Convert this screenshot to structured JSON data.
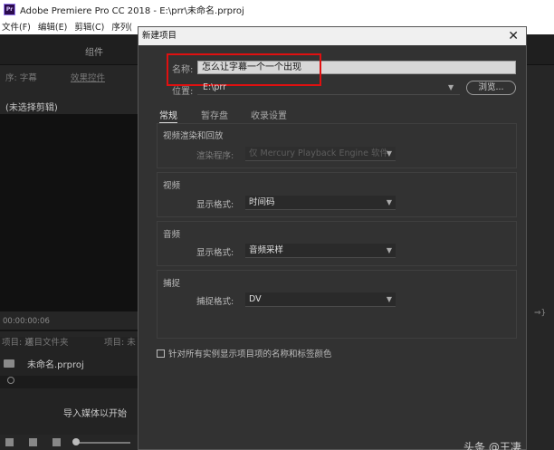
{
  "app": {
    "title": "Adobe Premiere Pro CC 2018 - E:\\prr\\未命名.prproj",
    "menu": [
      "文件(F)",
      "编辑(E)",
      "剪辑(C)",
      "序列("
    ]
  },
  "background": {
    "zujian": "组件",
    "left_tab_1": "序: 字幕",
    "left_tab_2": "效果控件",
    "no_clip": "(未选择剪辑)",
    "timecode": "00:00:00:06",
    "project_tab_1": "项目: 送",
    "project_tab_2": "项目文件夹",
    "project_tab_3": "项目: 未",
    "project_file": "未命名.prproj",
    "import_media": "导入媒体以开始",
    "right_arrow": "⇒}",
    "watermark": "头条 @王凄"
  },
  "dialog": {
    "title": "新建项目",
    "name_label": "名称:",
    "name_value": "怎么让字幕一个一个出现",
    "location_label": "位置:",
    "location_value": "E:\\prr",
    "browse_label": "浏览...",
    "tabs": [
      {
        "label": "常规",
        "active": true
      },
      {
        "label": "暂存盘",
        "active": false
      },
      {
        "label": "收录设置",
        "active": false
      }
    ],
    "sections": {
      "video_rendering": {
        "title": "视频渲染和回放",
        "renderer_label": "渲染程序:",
        "renderer_value": "仅 Mercury Playback Engine 软件"
      },
      "video": {
        "title": "视频",
        "format_label": "显示格式:",
        "format_value": "时间码"
      },
      "audio": {
        "title": "音频",
        "format_label": "显示格式:",
        "format_value": "音频采样"
      },
      "capture": {
        "title": "捕捉",
        "format_label": "捕捉格式:",
        "format_value": "DV"
      }
    },
    "checkbox_label": "针对所有实例显示项目项的名称和标签颜色"
  },
  "colors": {
    "highlight": "#e01010",
    "dialog_bg": "#323232",
    "panel_bg": "#232323"
  }
}
